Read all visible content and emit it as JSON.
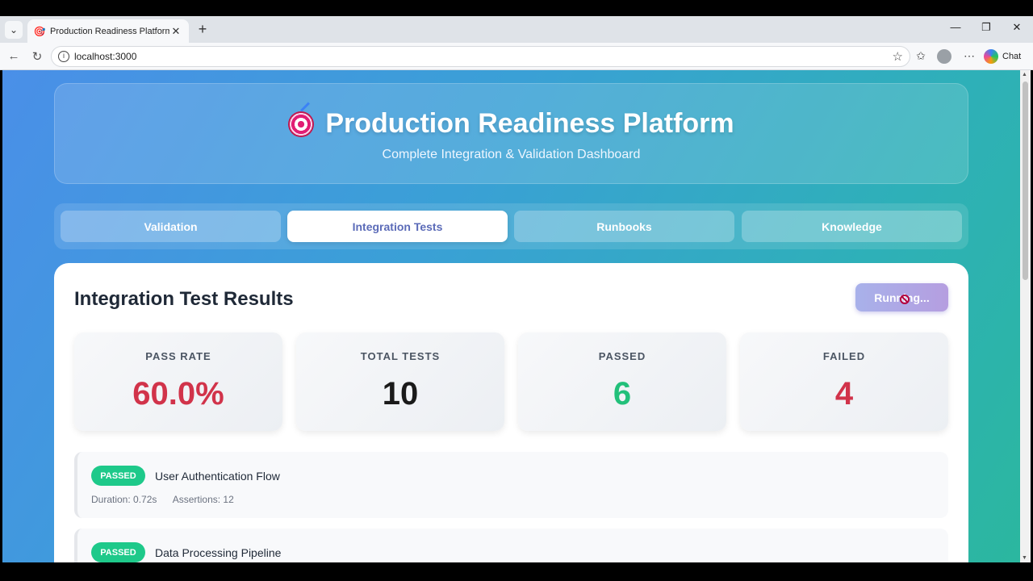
{
  "browser": {
    "tab_title": "Production Readiness Platform",
    "url": "localhost:3000",
    "chat_label": "Chat"
  },
  "header": {
    "title": "Production Readiness Platform",
    "subtitle": "Complete Integration & Validation Dashboard",
    "icon": "target-icon"
  },
  "nav": {
    "tabs": [
      {
        "label": "Validation",
        "active": false
      },
      {
        "label": "Integration Tests",
        "active": true
      },
      {
        "label": "Runbooks",
        "active": false
      },
      {
        "label": "Knowledge",
        "active": false
      }
    ]
  },
  "main": {
    "title": "Integration Test Results",
    "run_button_label": "Running...",
    "stats": [
      {
        "label": "PASS RATE",
        "value": "60.0%",
        "color": "#d1334a"
      },
      {
        "label": "TOTAL TESTS",
        "value": "10",
        "color": "#1a1a1a"
      },
      {
        "label": "PASSED",
        "value": "6",
        "color": "#22c07a"
      },
      {
        "label": "FAILED",
        "value": "4",
        "color": "#d1334a"
      }
    ],
    "results": [
      {
        "status": "PASSED",
        "name": "User Authentication Flow",
        "duration": "Duration: 0.72s",
        "assertions": "Assertions: 12"
      },
      {
        "status": "PASSED",
        "name": "Data Processing Pipeline",
        "duration": "",
        "assertions": ""
      }
    ]
  },
  "colors": {
    "accent": "#5b6bb8",
    "passed_badge": "#1ec98a"
  }
}
